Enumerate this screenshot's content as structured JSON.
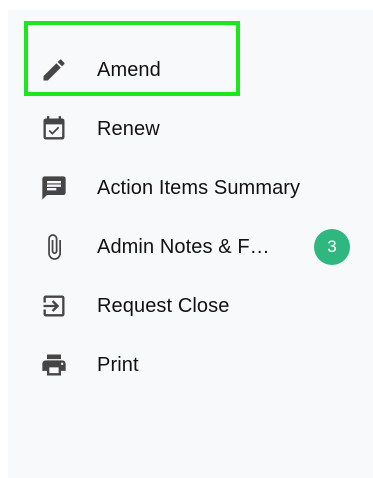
{
  "menu": {
    "items": [
      {
        "label": "Amend",
        "icon": "pencil-icon"
      },
      {
        "label": "Renew",
        "icon": "calendar-check-icon"
      },
      {
        "label": "Action Items Summary",
        "icon": "comment-icon"
      },
      {
        "label": "Admin Notes & F…",
        "icon": "paperclip-icon",
        "badge": "3"
      },
      {
        "label": "Request Close",
        "icon": "exit-icon"
      },
      {
        "label": "Print",
        "icon": "printer-icon"
      }
    ]
  },
  "colors": {
    "panel_background": "#f8f9fa",
    "icon": "#454545",
    "text": "#111111",
    "badge": "#2eb87f",
    "highlight_border": "#1ee61e"
  }
}
